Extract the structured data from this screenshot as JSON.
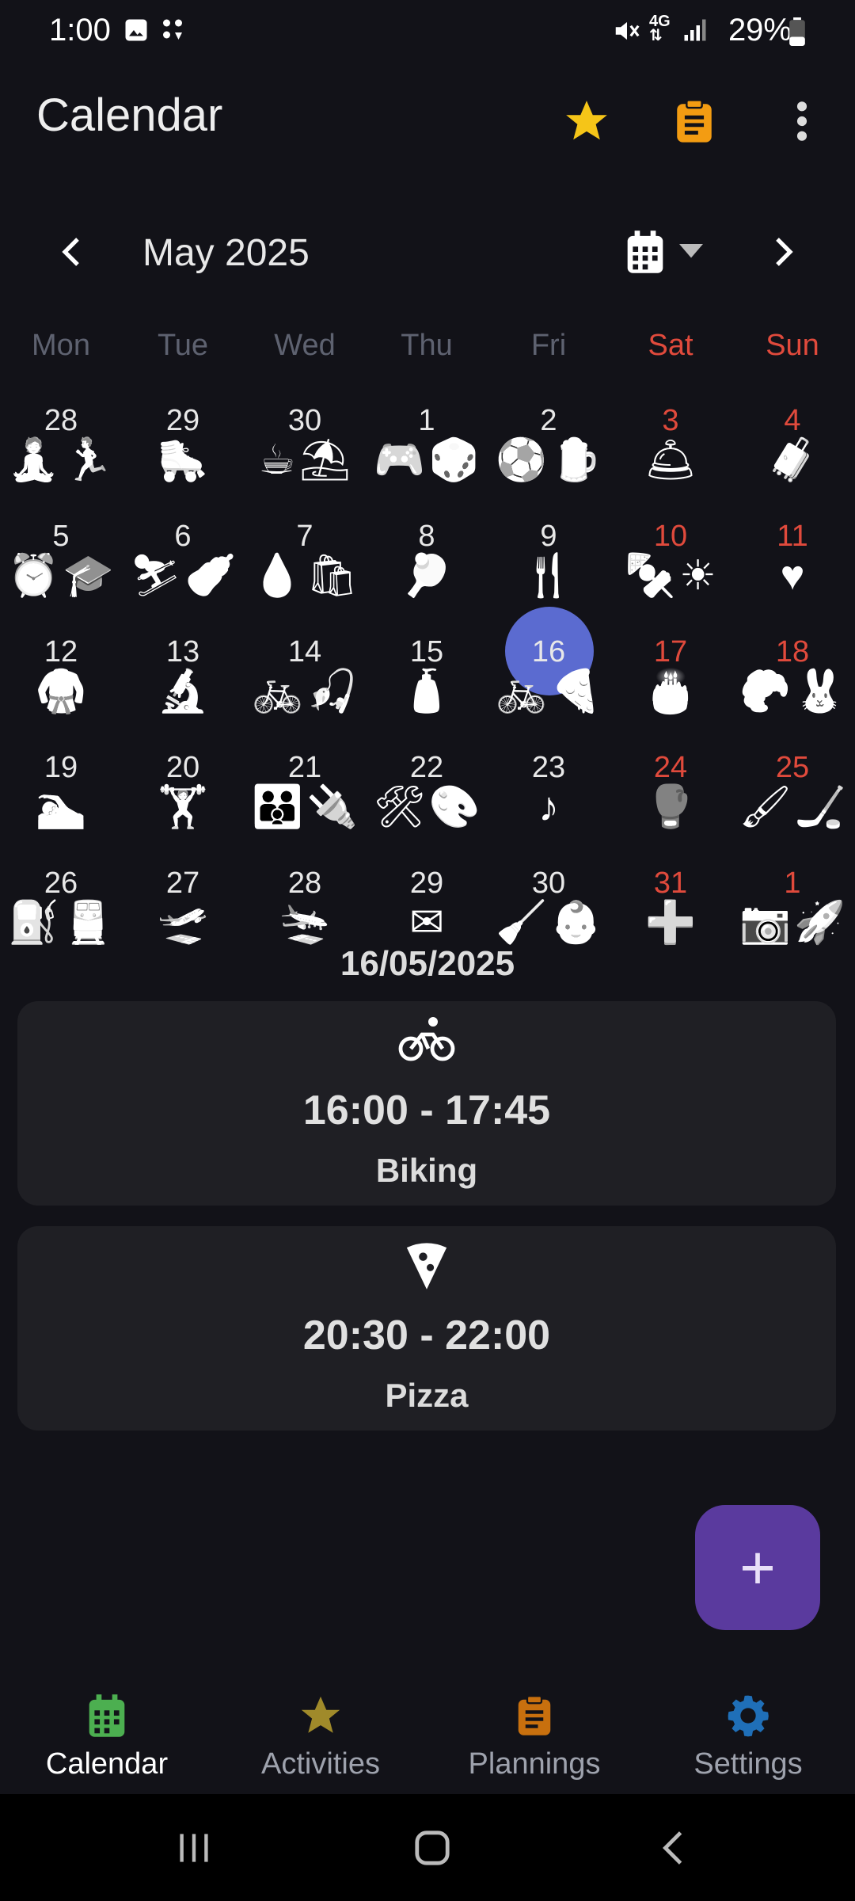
{
  "status_bar": {
    "time": "1:00",
    "battery": "29%"
  },
  "app_bar": {
    "title": "Calendar"
  },
  "month_nav": {
    "label": "May 2025"
  },
  "weekdays": [
    "Mon",
    "Tue",
    "Wed",
    "Thu",
    "Fri",
    "Sat",
    "Sun"
  ],
  "calendar": {
    "weeks": [
      [
        {
          "day": "28",
          "icons": [
            "🧘",
            "🏃"
          ]
        },
        {
          "day": "29",
          "icons": [
            "🛼"
          ]
        },
        {
          "day": "30",
          "icons": [
            "☕",
            "⛱"
          ]
        },
        {
          "day": "1",
          "icons": [
            "🎮",
            "🎲"
          ]
        },
        {
          "day": "2",
          "icons": [
            "⚽",
            "🍺"
          ]
        },
        {
          "day": "3",
          "icons": [
            "🛎"
          ]
        },
        {
          "day": "4",
          "icons": [
            "🧳"
          ]
        }
      ],
      [
        {
          "day": "5",
          "icons": [
            "⏰",
            "🎓"
          ]
        },
        {
          "day": "6",
          "icons": [
            "⛷",
            "🍼"
          ]
        },
        {
          "day": "7",
          "icons": [
            "💧",
            "🛍"
          ]
        },
        {
          "day": "8",
          "icons": [
            "🏓"
          ]
        },
        {
          "day": "9",
          "icons": [
            "🍴"
          ]
        },
        {
          "day": "10",
          "icons": [
            "🍢",
            "☀"
          ]
        },
        {
          "day": "11",
          "icons": [
            "♥"
          ]
        }
      ],
      [
        {
          "day": "12",
          "icons": [
            "🥋"
          ]
        },
        {
          "day": "13",
          "icons": [
            "🔬"
          ]
        },
        {
          "day": "14",
          "icons": [
            "🚲",
            "🎣"
          ]
        },
        {
          "day": "15",
          "icons": [
            "🧴"
          ]
        },
        {
          "day": "16",
          "icons": [
            "🚲",
            "🍕"
          ],
          "selected": true
        },
        {
          "day": "17",
          "icons": [
            "🎂"
          ]
        },
        {
          "day": "18",
          "icons": [
            "🥐",
            "🐰"
          ]
        }
      ],
      [
        {
          "day": "19",
          "icons": [
            "🏊"
          ]
        },
        {
          "day": "20",
          "icons": [
            "🏋"
          ]
        },
        {
          "day": "21",
          "icons": [
            "👪",
            "🔌"
          ]
        },
        {
          "day": "22",
          "icons": [
            "🛠",
            "🎨"
          ]
        },
        {
          "day": "23",
          "icons": [
            "♪"
          ]
        },
        {
          "day": "24",
          "icons": [
            "🥊"
          ]
        },
        {
          "day": "25",
          "icons": [
            "🖌",
            "🏒"
          ]
        }
      ],
      [
        {
          "day": "26",
          "icons": [
            "⛽",
            "🚆"
          ]
        },
        {
          "day": "27",
          "icons": [
            "🛫"
          ]
        },
        {
          "day": "28",
          "icons": [
            "🛬"
          ]
        },
        {
          "day": "29",
          "icons": [
            "✉"
          ]
        },
        {
          "day": "30",
          "icons": [
            "🧹",
            "👶"
          ]
        },
        {
          "day": "31",
          "icons": [
            "➕"
          ]
        },
        {
          "day": "1",
          "icons": [
            "📷",
            "🚀"
          ]
        }
      ]
    ]
  },
  "selected_date": "16/05/2025",
  "events": [
    {
      "icon": "bike-icon",
      "time": "16:00 - 17:45",
      "label": "Biking"
    },
    {
      "icon": "pizza-icon",
      "time": "20:30 - 22:00",
      "label": "Pizza"
    }
  ],
  "fab": {
    "label": "+"
  },
  "bottom_nav": [
    {
      "label": "Calendar",
      "icon": "calendar-icon",
      "color": "#4caf50",
      "active": true
    },
    {
      "label": "Activities",
      "icon": "star-icon",
      "color": "#a08a2a"
    },
    {
      "label": "Plannings",
      "icon": "clipboard-icon",
      "color": "#c8700e"
    },
    {
      "label": "Settings",
      "icon": "gear-icon",
      "color": "#1f6fb8"
    }
  ],
  "colors": {
    "accent_star": "#f5c518",
    "accent_clipboard": "#f39c12",
    "selected_day": "#5b6bd0",
    "weekend": "#e04a3c",
    "fab": "#5a3a9e"
  }
}
